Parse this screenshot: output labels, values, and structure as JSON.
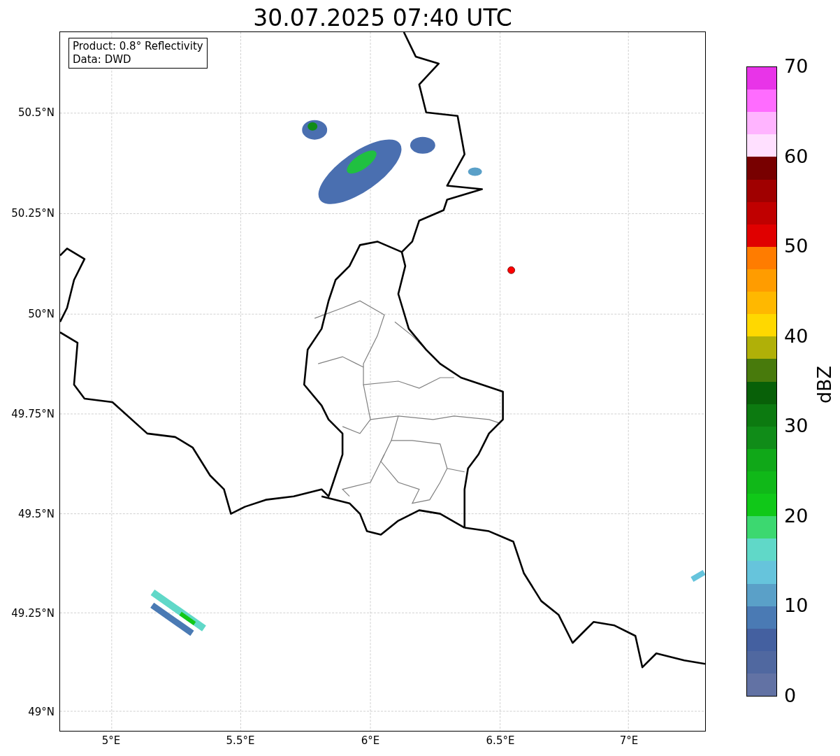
{
  "title": "30.07.2025 07:40 UTC",
  "legend_box": [
    "Product: 0.8° Reflectivity",
    "Data: DWD"
  ],
  "map": {
    "lat_labels": [
      "50.5°N",
      "50.25°N",
      "50°N",
      "49.75°N",
      "49.5°N",
      "49.25°N",
      "49°N"
    ],
    "lon_labels": [
      "5°E",
      "5.5°E",
      "6°E",
      "6.5°E",
      "7°E"
    ]
  },
  "colorbar": {
    "label": "dBZ",
    "ticks": [
      "70",
      "60",
      "50",
      "40",
      "30",
      "20",
      "10",
      "0"
    ],
    "segments": [
      {
        "color": "#e834e8"
      },
      {
        "color": "#ff6cff"
      },
      {
        "color": "#ffb4ff"
      },
      {
        "color": "#ffe0ff"
      },
      {
        "color": "#780000"
      },
      {
        "color": "#a00000"
      },
      {
        "color": "#c00000"
      },
      {
        "color": "#e00000"
      },
      {
        "color": "#ff7c00"
      },
      {
        "color": "#ff9c00"
      },
      {
        "color": "#ffb800"
      },
      {
        "color": "#ffd800"
      },
      {
        "color": "#b0b008"
      },
      {
        "color": "#487a0c"
      },
      {
        "color": "#086008"
      },
      {
        "color": "#0c7a10"
      },
      {
        "color": "#108c18"
      },
      {
        "color": "#10a818"
      },
      {
        "color": "#10b818"
      },
      {
        "color": "#10c818"
      },
      {
        "color": "#3cd870"
      },
      {
        "color": "#60d8c8"
      },
      {
        "color": "#66c4dc"
      },
      {
        "color": "#5aa0c8"
      },
      {
        "color": "#4a7ab4"
      },
      {
        "color": "#4460a0"
      },
      {
        "color": "#5068a0"
      },
      {
        "color": "#6272a4"
      }
    ]
  }
}
